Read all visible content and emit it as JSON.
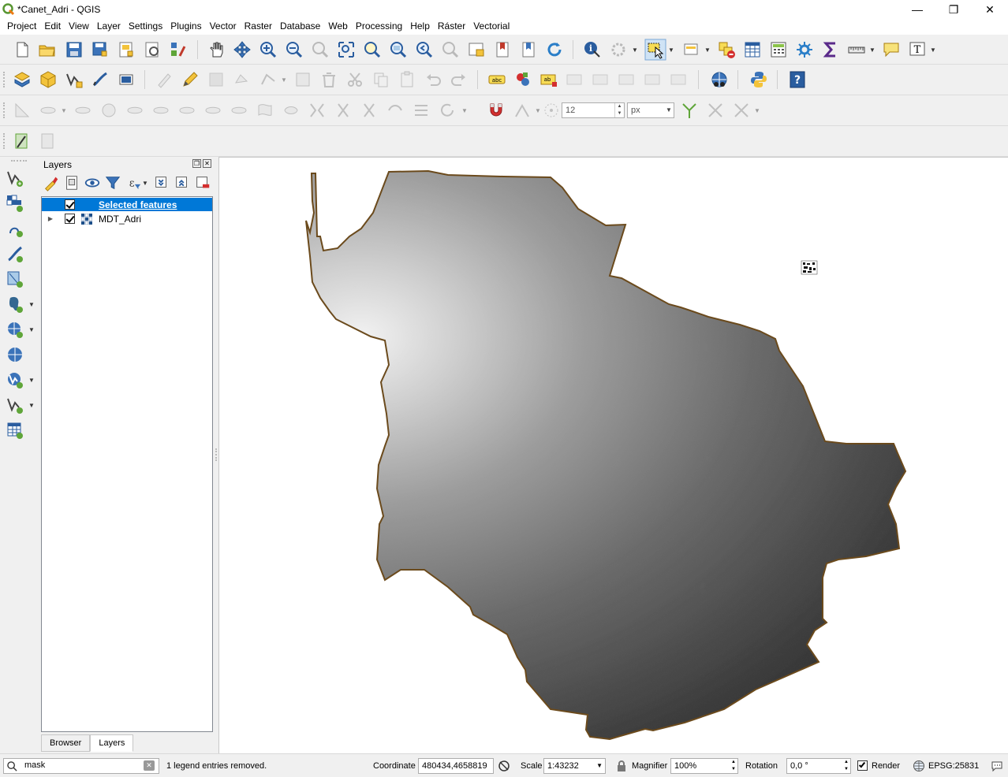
{
  "window": {
    "title": "*Canet_Adri - QGIS",
    "minimize_glyph": "—",
    "restore_glyph": "❐",
    "close_glyph": "✕"
  },
  "menubar": {
    "items": [
      "Project",
      "Edit",
      "View",
      "Layer",
      "Settings",
      "Plugins",
      "Vector",
      "Raster",
      "Database",
      "Web",
      "Processing",
      "Help",
      "Ráster",
      "Vectorial"
    ]
  },
  "digitizing_toolbar": {
    "font_size_value": "12",
    "unit_value": "px"
  },
  "layers_panel": {
    "title": "Layers",
    "layers": [
      {
        "label": "Selected features",
        "checked": true,
        "selected": true,
        "icon": "vector-layer-icon"
      },
      {
        "label": "MDT_Adri",
        "checked": true,
        "selected": false,
        "icon": "raster-layer-icon"
      }
    ],
    "tabs": [
      "Browser",
      "Layers"
    ],
    "active_tab": "Layers"
  },
  "statusbar": {
    "search_value": "mask",
    "message": "1 legend entries removed.",
    "coordinate_label": "Coordinate",
    "coordinate_value": "480434,4658819",
    "scale_label": "Scale",
    "scale_value": "1:43232",
    "magnifier_label": "Magnifier",
    "magnifier_value": "100%",
    "rotation_label": "Rotation",
    "rotation_value": "0,0 °",
    "render_label": "Render",
    "render_checked": true,
    "crs_value": "EPSG:25831"
  },
  "colors": {
    "selection_blue": "#0078d7",
    "boundary_brown": "#6b4a1c",
    "dem_light": "#e6e6e6",
    "dem_dark": "#1a1a1a"
  }
}
